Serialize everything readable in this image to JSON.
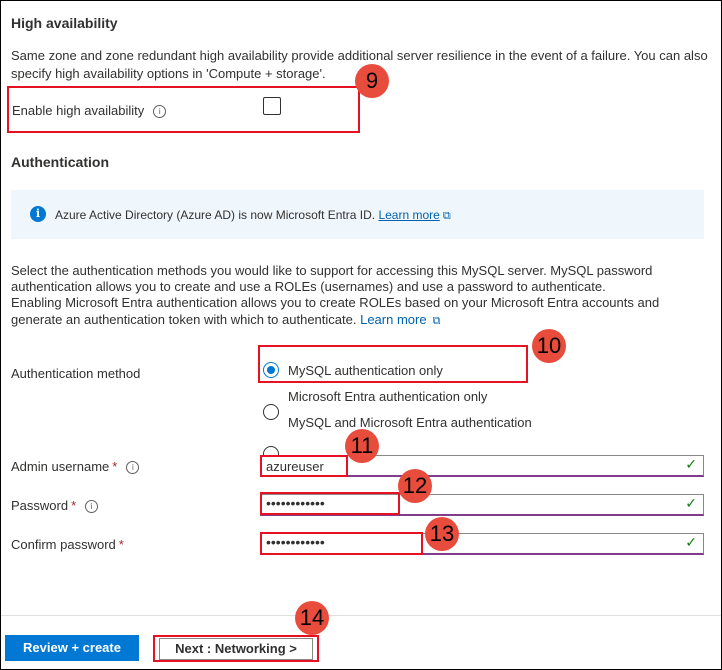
{
  "high_availability": {
    "title": "High availability",
    "description_line1": "Same zone and zone redundant high availability provide additional server resilience in the event of a failure. You can also",
    "description_line2": "specify high availability options in 'Compute + storage'.",
    "enable_label": "Enable high availability",
    "enable_checked": false
  },
  "authentication": {
    "title": "Authentication",
    "banner_text": "Azure Active Directory (Azure AD) is now Microsoft Entra ID.",
    "banner_link": "Learn more",
    "desc_line1": "Select the authentication methods you would like to support for accessing this MySQL server. MySQL password",
    "desc_line2": "authentication allows you to create and use a ROLEs (usernames) and use a password to authenticate.",
    "desc_line3": "Enabling Microsoft Entra authentication allows you to create ROLEs based on your Microsoft Entra accounts and",
    "desc_line4": "generate an authentication token with which to authenticate.",
    "desc_link": "Learn more",
    "method_label": "Authentication method",
    "options": [
      {
        "label": "MySQL authentication only",
        "selected": true
      },
      {
        "label": "Microsoft Entra authentication only",
        "selected": false
      },
      {
        "label": "MySQL and Microsoft Entra authentication",
        "selected": false
      }
    ],
    "admin_username_label": "Admin username",
    "admin_username_value": "azureuser",
    "password_label": "Password",
    "password_value": "••••••••••••",
    "confirm_password_label": "Confirm password",
    "confirm_password_value": "••••••••••••",
    "required_marker": "*"
  },
  "badges": {
    "b9": "9",
    "b10": "10",
    "b11": "11",
    "b12": "12",
    "b13": "13",
    "b14": "14"
  },
  "footer": {
    "review_create": "Review + create",
    "next_networking": "Next : Networking >"
  },
  "icons": {
    "info": "info-icon",
    "external": "external-link-icon",
    "check": "checkmark-icon"
  },
  "colors": {
    "accent": "#0078d4",
    "annotation": "#e81123",
    "badge": "#e74c3c",
    "valid": "#107c10"
  }
}
